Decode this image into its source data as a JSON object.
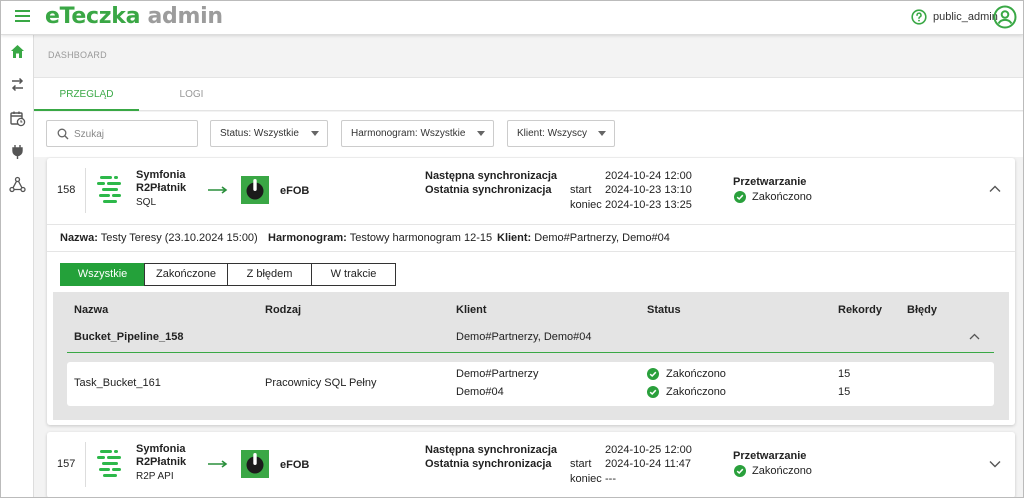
{
  "header": {
    "logo_part1": "eTeczka",
    "logo_part2": "admin",
    "username": "public_admin"
  },
  "breadcrumb": "DASHBOARD",
  "tabs": [
    {
      "label": "PRZEGLĄD",
      "active": true
    },
    {
      "label": "LOGI",
      "active": false
    }
  ],
  "filters": {
    "search_placeholder": "Szukaj",
    "status_label": "Status: Wszystkie",
    "schedule_label": "Harmonogram: Wszystkie",
    "client_label": "Klient: Wszyscy"
  },
  "jobs": [
    {
      "id": "158",
      "source_title_1": "Symfonia",
      "source_title_2": "R2Płatnik",
      "source_sub": "SQL",
      "target": "eFOB",
      "next_sync_label": "Następna synchronizacja",
      "last_sync_label": "Ostatnia synchronizacja",
      "start_label": "start",
      "end_label": "koniec",
      "next_sync": "2024-10-24 12:00",
      "last_start": "2024-10-23 13:10",
      "last_end": "2024-10-23 13:25",
      "processing_label": "Przetwarzanie",
      "processing_status": "Zakończono",
      "expanded": true,
      "details": {
        "name_label": "Nazwa:",
        "name_value": "Testy Teresy (23.10.2024 15:00)",
        "schedule_label": "Harmonogram:",
        "schedule_value": "Testowy harmonogram 12-15",
        "client_label": "Klient:",
        "client_value": "Demo#Partnerzy, Demo#04"
      },
      "segments": [
        "Wszystkie",
        "Zakończone",
        "Z błędem",
        "W trakcie"
      ],
      "columns": [
        "Nazwa",
        "Rodzaj",
        "Klient",
        "Status",
        "Rekordy",
        "Błędy"
      ],
      "group": {
        "name": "Bucket_Pipeline_158",
        "client": "Demo#Partnerzy, Demo#04"
      },
      "task": {
        "name": "Task_Bucket_161",
        "type": "Pracownicy SQL Pełny",
        "client_1": "Demo#Partnerzy",
        "client_2": "Demo#04",
        "status_1": "Zakończono",
        "status_2": "Zakończono",
        "records_1": "15",
        "records_2": "15"
      }
    },
    {
      "id": "157",
      "source_title_1": "Symfonia",
      "source_title_2": "R2Płatnik",
      "source_sub": "R2P API",
      "target": "eFOB",
      "next_sync_label": "Następna synchronizacja",
      "last_sync_label": "Ostatnia synchronizacja",
      "start_label": "start",
      "end_label": "koniec",
      "next_sync": "2024-10-25 12:00",
      "last_start": "2024-10-24 11:47",
      "last_end": "---",
      "processing_label": "Przetwarzanie",
      "processing_status": "Zakończono",
      "expanded": false
    }
  ],
  "colors": {
    "brand_green": "#3aa745",
    "active_segment": "#24a13a",
    "logo_grey": "#9c9c9c"
  }
}
